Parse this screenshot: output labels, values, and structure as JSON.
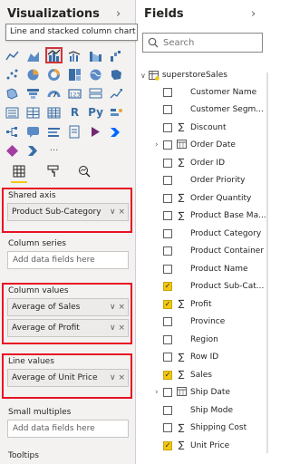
{
  "visualizations": {
    "title": "Visualizations",
    "tooltip": "Line and stacked column chart",
    "collapse_glyph": "›",
    "more_glyph": "···",
    "icon_letters": {
      "r": "R",
      "py": "Py"
    },
    "sections": {
      "shared_axis": {
        "label": "Shared axis",
        "fields": [
          "Product Sub-Category"
        ]
      },
      "column_series": {
        "label": "Column series",
        "placeholder": "Add data fields here"
      },
      "column_values": {
        "label": "Column values",
        "fields": [
          "Average of Sales",
          "Average of Profit"
        ]
      },
      "line_values": {
        "label": "Line values",
        "fields": [
          "Average of Unit Price"
        ]
      },
      "small_multiples": {
        "label": "Small multiples",
        "placeholder": "Add data fields here"
      },
      "tooltips": {
        "label": "Tooltips"
      }
    },
    "pill_actions": "∨ ×",
    "highlight_color": "#e81123",
    "selected_icon": "line-and-stacked-column-chart"
  },
  "fields": {
    "title": "Fields",
    "collapse_glyph": "›",
    "search_placeholder": "Search",
    "table_name": "superstoreSales",
    "items": [
      {
        "name": "Customer Name",
        "type": "",
        "checked": false,
        "expandable": false
      },
      {
        "name": "Customer Segm...",
        "type": "",
        "checked": false,
        "expandable": false
      },
      {
        "name": "Discount",
        "type": "∑",
        "checked": false,
        "expandable": false
      },
      {
        "name": "Order Date",
        "type": "calendar",
        "checked": false,
        "expandable": true
      },
      {
        "name": "Order ID",
        "type": "∑",
        "checked": false,
        "expandable": false
      },
      {
        "name": "Order Priority",
        "type": "",
        "checked": false,
        "expandable": false
      },
      {
        "name": "Order Quantity",
        "type": "∑",
        "checked": false,
        "expandable": false
      },
      {
        "name": "Product Base Ma...",
        "type": "∑",
        "checked": false,
        "expandable": false
      },
      {
        "name": "Product Category",
        "type": "",
        "checked": false,
        "expandable": false
      },
      {
        "name": "Product Container",
        "type": "",
        "checked": false,
        "expandable": false
      },
      {
        "name": "Product Name",
        "type": "",
        "checked": false,
        "expandable": false
      },
      {
        "name": "Product Sub-Cat...",
        "type": "",
        "checked": true,
        "expandable": false
      },
      {
        "name": "Profit",
        "type": "∑",
        "checked": true,
        "expandable": false
      },
      {
        "name": "Province",
        "type": "",
        "checked": false,
        "expandable": false
      },
      {
        "name": "Region",
        "type": "",
        "checked": false,
        "expandable": false
      },
      {
        "name": "Row ID",
        "type": "∑",
        "checked": false,
        "expandable": false
      },
      {
        "name": "Sales",
        "type": "∑",
        "checked": true,
        "expandable": false
      },
      {
        "name": "Ship Date",
        "type": "calendar",
        "checked": false,
        "expandable": true
      },
      {
        "name": "Ship Mode",
        "type": "",
        "checked": false,
        "expandable": false
      },
      {
        "name": "Shipping Cost",
        "type": "∑",
        "checked": false,
        "expandable": false
      },
      {
        "name": "Unit Price",
        "type": "∑",
        "checked": true,
        "expandable": false
      }
    ],
    "check_color": "#f2c811"
  }
}
